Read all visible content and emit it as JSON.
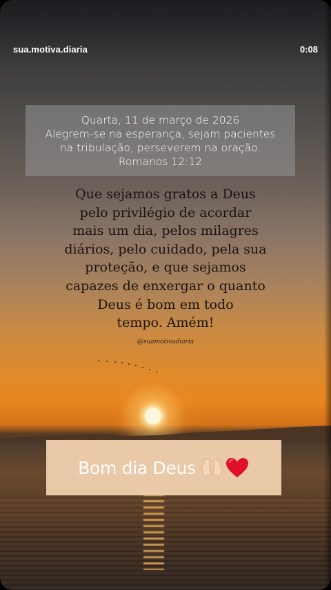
{
  "story": {
    "account_name": "sua.motiva.diaria",
    "elapsed_time": "0:08"
  },
  "verse": {
    "lines": [
      "Quarta, 11 de março de 2026",
      "Alegrem-se na esperança, sejam pacientes",
      "na tribulação, perseverem na oração.",
      "Romanos 12:12"
    ]
  },
  "prayer": {
    "lines": [
      "Que sejamos gratos a Deus",
      "pelo privilégio de acordar",
      "mais um dia, pelos milagres",
      "diários, pelo cuidado, pela sua",
      "proteção, e que sejamos",
      "capazes de enxergar o quanto",
      "Deus é bom em todo",
      "tempo. Amém!"
    ],
    "handle": "@suamotivadiaria"
  },
  "sticker": {
    "text": "Bom dia Deus",
    "icons": [
      "raised-hands-icon",
      "heart-icon"
    ],
    "background_color": "#e9c9a7"
  }
}
